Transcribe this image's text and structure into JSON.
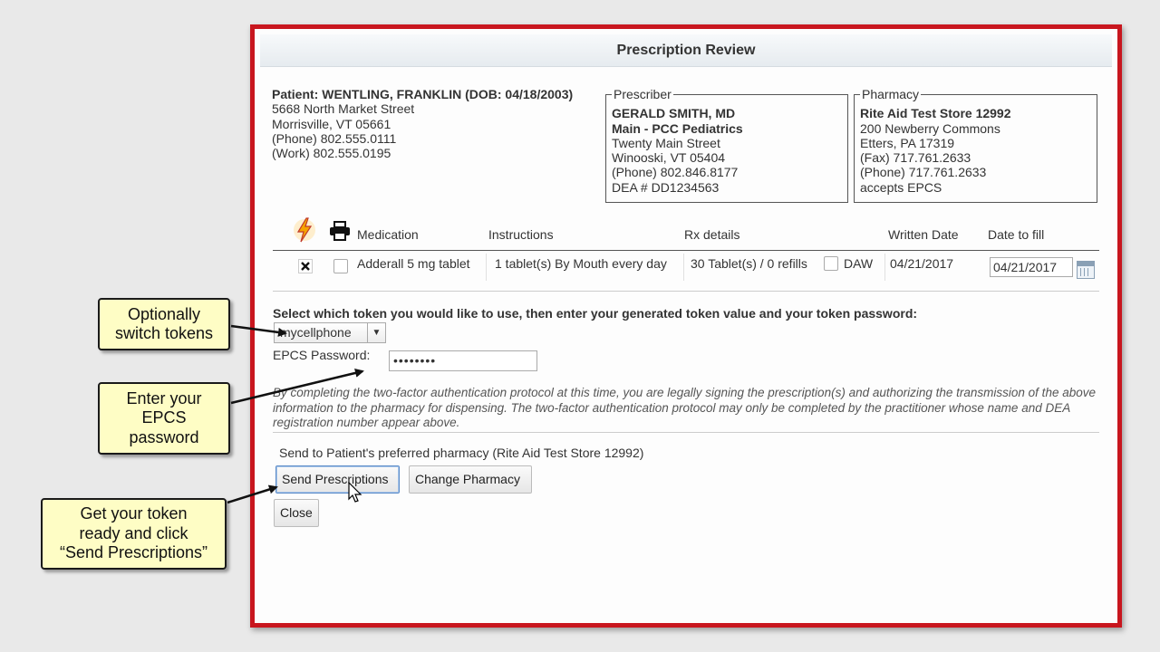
{
  "dialog": {
    "title": "Prescription Review"
  },
  "patient": {
    "name_line": "Patient: WENTLING, FRANKLIN (DOB: 04/18/2003)",
    "address1": "5668 North Market Street",
    "address2": "Morrisville, VT 05661",
    "phone": "(Phone) 802.555.0111",
    "work": "(Work) 802.555.0195"
  },
  "prescriber": {
    "legend": "Prescriber",
    "name": "GERALD SMITH, MD",
    "practice": "Main - PCC Pediatrics",
    "address1": "Twenty Main Street",
    "address2": "Winooski, VT 05404",
    "phone": "(Phone) 802.846.8177",
    "dea": "DEA # DD1234563"
  },
  "pharmacy": {
    "legend": "Pharmacy",
    "name": "Rite Aid Test Store 12992",
    "address1": "200 Newberry Commons",
    "address2": "Etters, PA 17319",
    "fax": "(Fax) 717.761.2633",
    "phone": "(Phone) 717.761.2633",
    "epcs": "accepts EPCS"
  },
  "table": {
    "headers": [
      "Medication",
      "Instructions",
      "Rx details",
      "Written Date",
      "Date to fill"
    ],
    "rows": [
      {
        "medication": "Adderall 5 mg tablet",
        "instructions": "1 tablet(s) By Mouth every day",
        "rx_details": "30 Tablet(s) / 0 refills",
        "daw_label": "DAW",
        "written_date": "04/21/2017",
        "date_to_fill": "04/21/2017"
      }
    ]
  },
  "token": {
    "instruction": "Select which token you would like to use, then enter your generated token value and your token password:",
    "selected": "mycellphone",
    "password_label": "EPCS Password:",
    "password_value": "••••••••"
  },
  "legal_text": "By completing the two-factor authentication protocol at this time, you are legally signing the prescription(s) and authorizing the transmission of the above information to the pharmacy for dispensing. The two-factor authentication protocol may only be completed by the practitioner whose name and DEA registration number appear above.",
  "send_to": "Send to Patient's preferred pharmacy (Rite Aid Test Store 12992)",
  "buttons": {
    "send": "Send Prescriptions",
    "change_pharmacy": "Change Pharmacy",
    "close": "Close"
  },
  "callouts": {
    "switch": "Optionally\nswitch tokens",
    "password": "Enter your\nEPCS\npassword",
    "send": "Get your token\nready and click\n“Send Prescriptions”"
  },
  "icons": {
    "epcs": "lightning-bolt-icon",
    "print": "printer-icon",
    "remove": "close-box-icon",
    "calendar": "calendar-icon",
    "dropdown": "chevron-down-icon"
  },
  "colors": {
    "dialog_border": "#c8161e",
    "callout_bg": "#fefdc5",
    "bolt": "#f5a300"
  }
}
